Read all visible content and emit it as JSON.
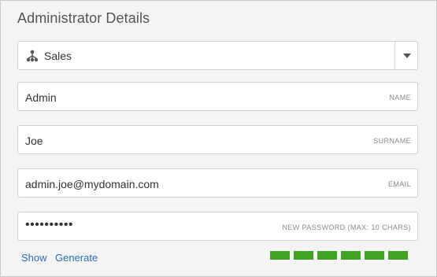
{
  "title": "Administrator Details",
  "department": {
    "selected": "Sales",
    "icon": "org-chart-icon"
  },
  "fields": {
    "name": {
      "value": "Admin",
      "hint": "NAME"
    },
    "surname": {
      "value": "Joe",
      "hint": "SURNAME"
    },
    "email": {
      "value": "admin.joe@mydomain.com",
      "hint": "EMAIL"
    },
    "password": {
      "masked": "••••••••••",
      "hint": "NEW PASSWORD (MAX: 10 CHARS)"
    }
  },
  "links": {
    "show": "Show",
    "generate": "Generate"
  },
  "strength": {
    "filled": 6,
    "total": 6,
    "color": "#3ea320"
  }
}
